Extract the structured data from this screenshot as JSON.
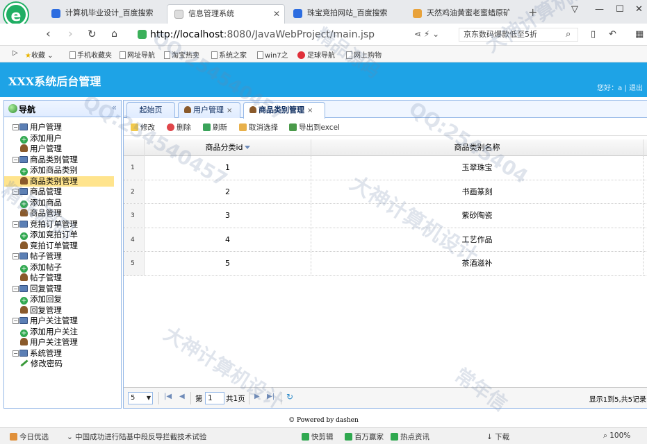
{
  "browser": {
    "tabs": [
      {
        "label": "计算机毕业设计_百度搜索",
        "icon": "paw-icon",
        "color": "#2d6de0"
      },
      {
        "label": "信息管理系统",
        "icon": "page-icon",
        "color": "#cccccc"
      },
      {
        "label": "珠宝竞拍网站_百度搜索",
        "icon": "paw-icon",
        "color": "#2d6de0"
      },
      {
        "label": "天然鸡油黄蜜老蜜蜡原矿手",
        "icon": "shop-icon",
        "color": "#e8a23a"
      }
    ],
    "new_tab": "+",
    "url_host": "http://localhost",
    "url_path": ":8080/JavaWebProject/main.jsp",
    "search_text": "京东数码爆款低至5折",
    "favorites": [
      "收藏",
      "手机收藏夹",
      "网址导航",
      "淘宝热卖",
      "系统之家",
      "win7之",
      "足球导航",
      "网上购物"
    ]
  },
  "header": {
    "title": "XXX系统后台管理",
    "user_prefix": "您好：",
    "user_name": "a",
    "sep": "|",
    "logout": "退出"
  },
  "sidebar": {
    "title": "导航",
    "collapse": "«",
    "groups": [
      {
        "label": "用户管理",
        "items": [
          "添加用户",
          "用户管理"
        ]
      },
      {
        "label": "商品类别管理",
        "items": [
          "添加商品类别",
          "商品类别管理"
        ]
      },
      {
        "label": "商品管理",
        "items": [
          "添加商品",
          "商品管理"
        ]
      },
      {
        "label": "竞拍订单管理",
        "items": [
          "添加竞拍订单",
          "竞拍订单管理"
        ]
      },
      {
        "label": "帖子管理",
        "items": [
          "添加帖子",
          "帖子管理"
        ]
      },
      {
        "label": "回复管理",
        "items": [
          "添加回复",
          "回复管理"
        ]
      },
      {
        "label": "用户关注管理",
        "items": [
          "添加用户关注",
          "用户关注管理"
        ]
      },
      {
        "label": "系统管理",
        "items": [
          "修改密码"
        ]
      }
    ]
  },
  "panel_tabs": [
    {
      "label": "起始页",
      "close": false
    },
    {
      "label": "用户管理",
      "close": true
    },
    {
      "label": "商品类别管理",
      "close": true
    }
  ],
  "toolbar": {
    "edit": "修改",
    "delete": "删除",
    "refresh": "刷新",
    "cancel_select": "取消选择",
    "export": "导出到excel"
  },
  "grid": {
    "columns": [
      "商品分类id",
      "商品类别名称"
    ],
    "rows": [
      {
        "num": "1",
        "id": "1",
        "name": "玉翠珠宝"
      },
      {
        "num": "2",
        "id": "2",
        "name": "书画篆刻"
      },
      {
        "num": "3",
        "id": "3",
        "name": "紫砂陶瓷"
      },
      {
        "num": "4",
        "id": "4",
        "name": "工艺作品"
      },
      {
        "num": "5",
        "id": "5",
        "name": "茶酒滋补"
      }
    ]
  },
  "pager": {
    "page_size": "5",
    "page_label": "第",
    "page_value": "1",
    "total_label": "共1页",
    "info": "显示1到5,共5记录"
  },
  "footer": "© Powered by dashen",
  "statusbar": {
    "items": [
      "今日优选",
      "中国成功进行陆基中段反导拦截技术试验",
      "快剪辑",
      "百万赢家",
      "热点资讯",
      "下载",
      "100%"
    ]
  },
  "watermarks": [
    "QQ:254540457",
    "大神计算机设计",
    "精品源码",
    "常年信",
    "QQ:254540457",
    "大神计算机设计",
    "精品源码",
    "QQ:2545404",
    "大神计算机设计",
    "常年信"
  ]
}
